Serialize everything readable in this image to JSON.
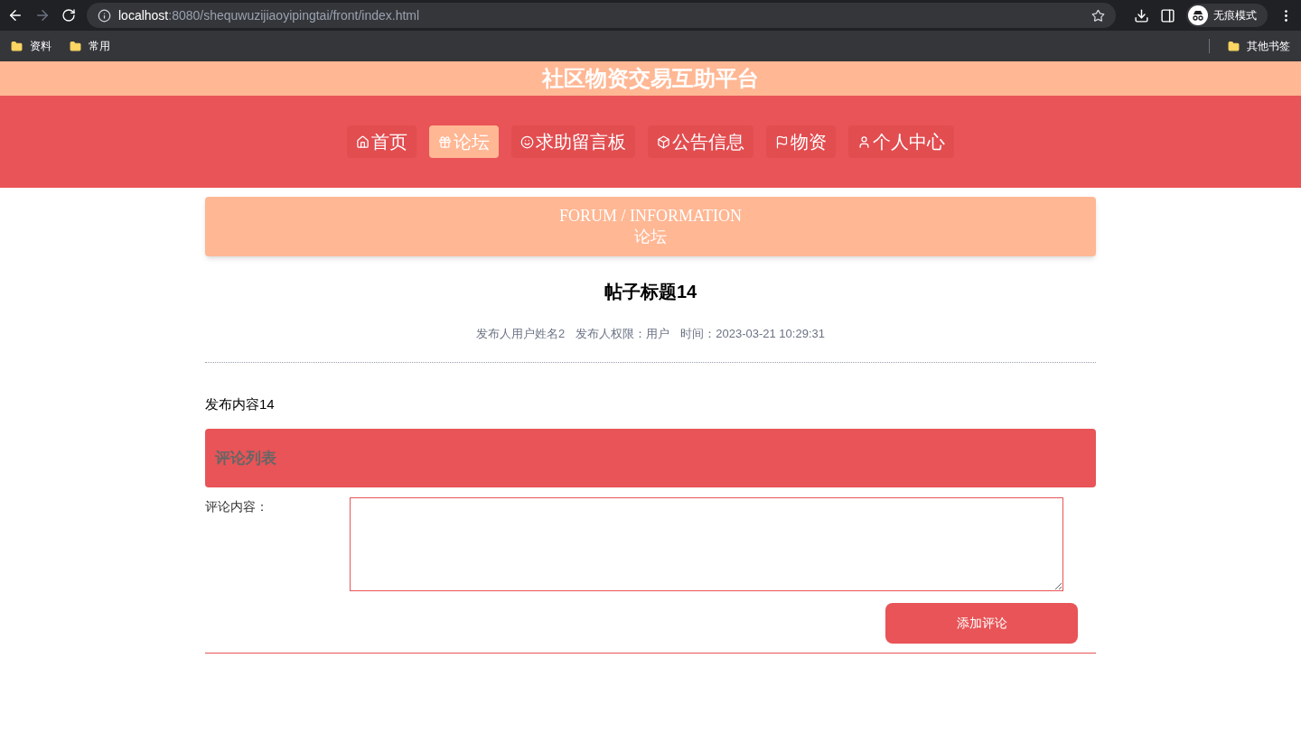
{
  "browser": {
    "url_host": "localhost",
    "url_path": ":8080/shequwuzijiaoyipingtai/front/index.html",
    "profile": "无痕模式",
    "bookmarks": [
      "资料",
      "常用"
    ],
    "other_bookmarks": "其他书签"
  },
  "site": {
    "title": "社区物资交易互助平台"
  },
  "nav": [
    {
      "label": "首页",
      "selected": false
    },
    {
      "label": "论坛",
      "selected": true
    },
    {
      "label": "求助留言板",
      "selected": false
    },
    {
      "label": "公告信息",
      "selected": false
    },
    {
      "label": "物资",
      "selected": false
    },
    {
      "label": "个人中心",
      "selected": false
    }
  ],
  "banner": {
    "title_en": "FORUM / INFORMATION",
    "title_zh": "论坛"
  },
  "post": {
    "title": "帖子标题14",
    "author": "发布人用户姓名2",
    "role": "发布人权限：用户",
    "time": "时间：2023-03-21 10:29:31",
    "content": "发布内容14"
  },
  "comments": {
    "heading": "评论列表",
    "field_label": "评论内容：",
    "submit": "添加评论"
  }
}
